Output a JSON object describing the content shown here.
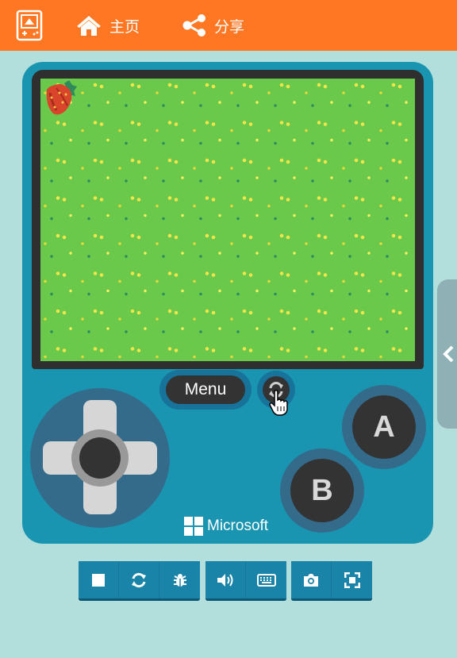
{
  "header": {
    "logo_icon": "gamepad-logo-icon",
    "nav": [
      {
        "label": "主页",
        "icon": "home-icon"
      },
      {
        "label": "分享",
        "icon": "share-icon"
      }
    ],
    "color": "#ff7722"
  },
  "simulator": {
    "menu_label": "Menu",
    "restart_icon": "refresh-icon",
    "button_a": "A",
    "button_b": "B",
    "brand": "Microsoft",
    "body_color": "#1a95b1",
    "screen_sprite": "strawberry"
  },
  "toolbar": {
    "groups": [
      [
        "stop-icon",
        "restart-icon",
        "debug-bug-icon"
      ],
      [
        "sound-icon",
        "keyboard-icon"
      ],
      [
        "screenshot-camera-icon",
        "fullscreen-icon"
      ]
    ]
  }
}
